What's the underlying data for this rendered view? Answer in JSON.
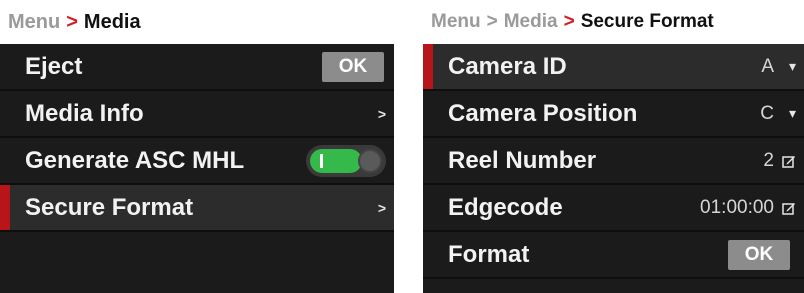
{
  "left_panel": {
    "breadcrumb": {
      "root": "Menu",
      "separator": ">",
      "current": "Media"
    },
    "items": [
      {
        "label": "Eject",
        "button": "OK"
      },
      {
        "label": "Media Info",
        "chevron": ">"
      },
      {
        "label": "Generate ASC MHL",
        "toggle_on": true
      },
      {
        "label": "Secure Format",
        "chevron": ">",
        "selected": true
      }
    ]
  },
  "right_panel": {
    "breadcrumb": {
      "root": "Menu",
      "separator1": ">",
      "middle": "Media",
      "separator2": ">",
      "current": "Secure Format"
    },
    "items": [
      {
        "label": "Camera ID",
        "value": "A",
        "icon": "dropdown",
        "selected": true
      },
      {
        "label": "Camera Position",
        "value": "C",
        "icon": "dropdown"
      },
      {
        "label": "Reel Number",
        "value": "2",
        "icon": "edit"
      },
      {
        "label": "Edgecode",
        "value": "01:00:00",
        "icon": "edit"
      },
      {
        "label": "Format",
        "button": "OK"
      }
    ]
  },
  "colors": {
    "panel_bg": "#1b1b1b",
    "selected_row_bg": "#2c2c2c",
    "selection_indicator": "#b8151b",
    "breadcrumb_arrow": "#d21f26",
    "toggle_on": "#35b94a",
    "ok_button": "#8c8c8c"
  }
}
